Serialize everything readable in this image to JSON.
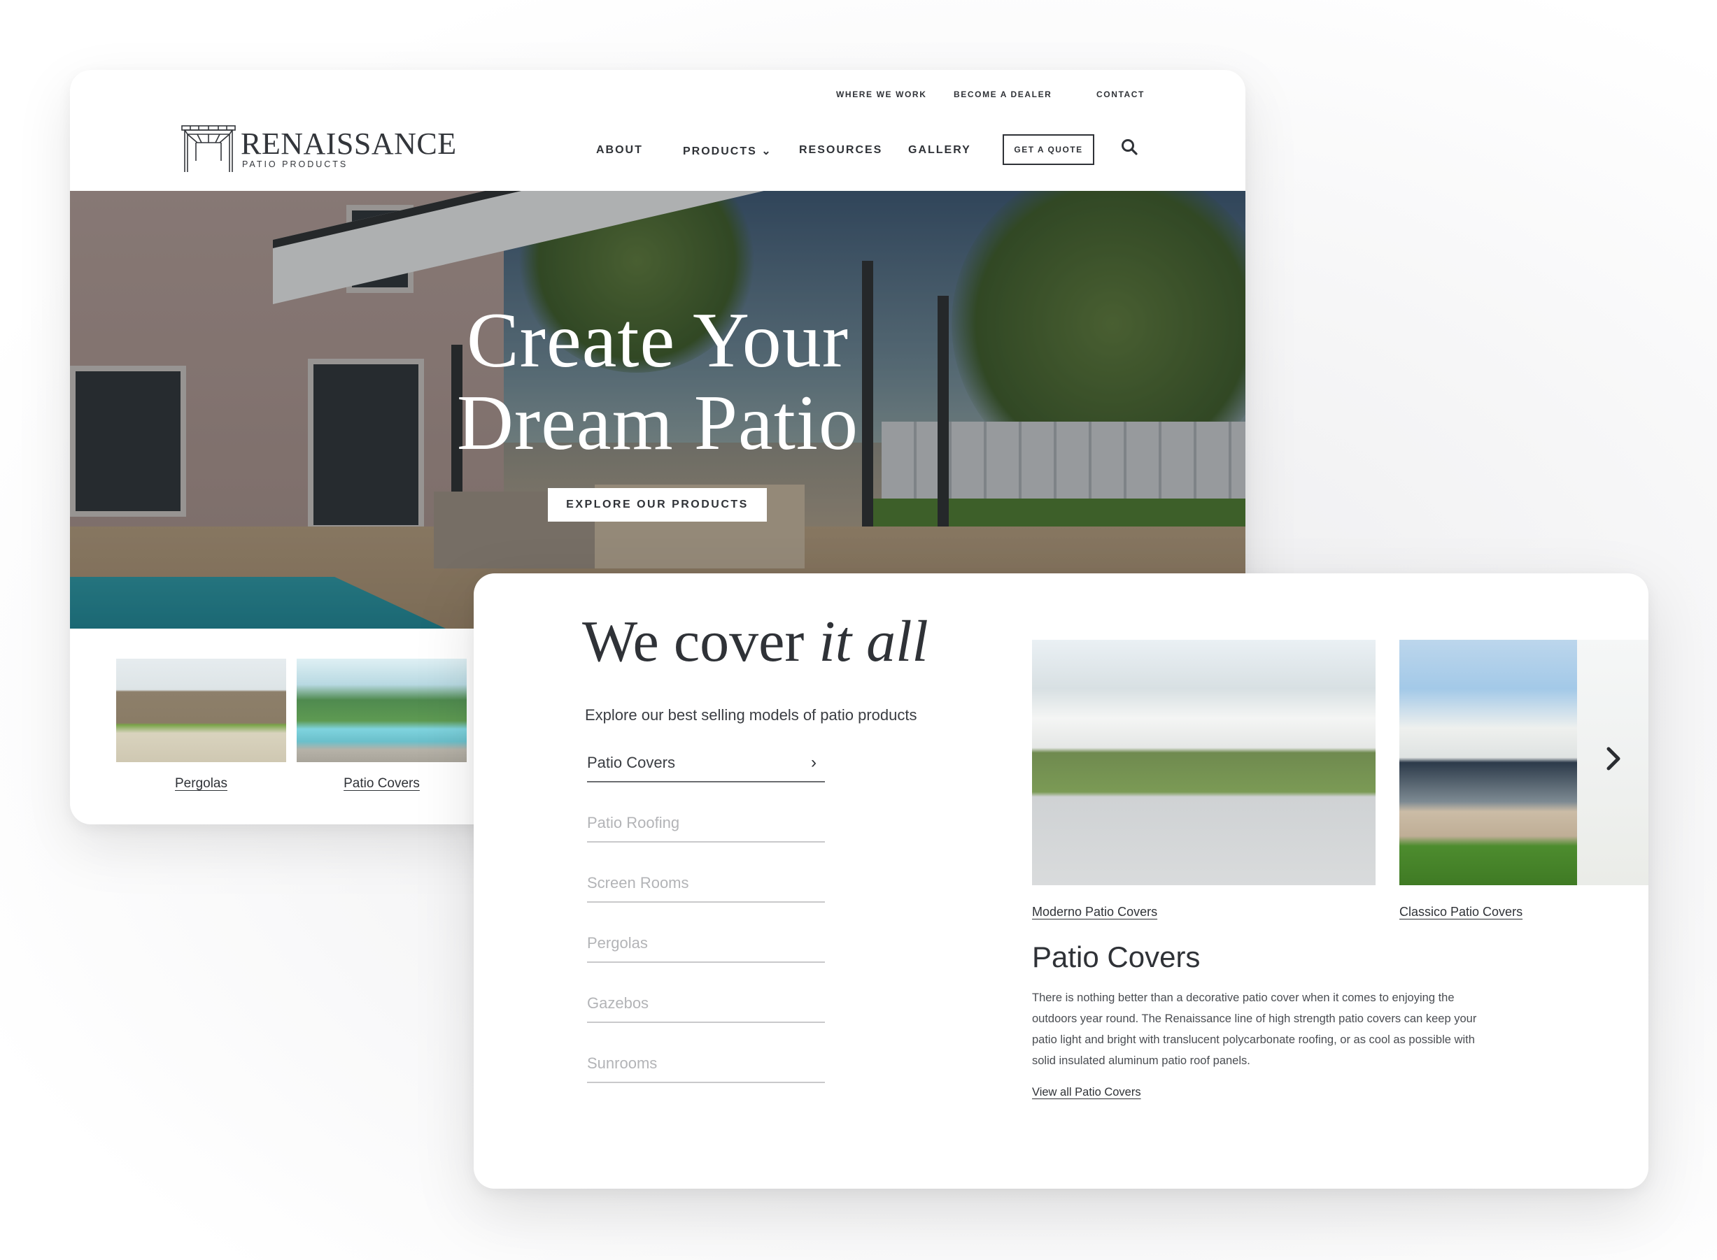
{
  "header": {
    "utility_links": [
      "WHERE WE WORK",
      "BECOME A DEALER",
      "CONTACT"
    ],
    "logo": {
      "wordmark": "RENAISSANCE",
      "tagline": "PATIO PRODUCTS"
    },
    "nav": [
      {
        "label": "ABOUT"
      },
      {
        "label": "PRODUCTS ⌄",
        "has_dropdown": true
      },
      {
        "label": "RESOURCES"
      },
      {
        "label": "GALLERY"
      }
    ],
    "cta_label": "GET A QUOTE",
    "search_icon": "search-icon"
  },
  "hero": {
    "title_line1": "Create Your",
    "title_line2": "Dream Patio",
    "button_label": "EXPLORE OUR PRODUCTS"
  },
  "featured": [
    {
      "label": "Pergolas"
    },
    {
      "label": "Patio Covers"
    }
  ],
  "products_section": {
    "title_regular": "We cover ",
    "title_italic": "it all",
    "subtitle": "Explore our best selling models of patio products",
    "categories": [
      {
        "label": "Patio Covers",
        "active": true
      },
      {
        "label": "Patio Roofing",
        "active": false
      },
      {
        "label": "Screen Rooms",
        "active": false
      },
      {
        "label": "Pergolas",
        "active": false
      },
      {
        "label": "Gazebos",
        "active": false
      },
      {
        "label": "Sunrooms",
        "active": false
      }
    ],
    "carousel": [
      {
        "label": "Moderno Patio Covers"
      },
      {
        "label": "Classico Patio Covers"
      }
    ],
    "next_icon": "chevron-right-icon",
    "detail_title": "Patio Covers",
    "detail_text": "There is nothing better than a decorative patio cover when it comes to enjoying the outdoors year round. The Renaissance line of high strength patio covers can keep your patio light and bright with translucent polycarbonate roofing, or as cool as possible with solid insulated aluminum patio roof panels.",
    "detail_link": "View all Patio Covers"
  },
  "colors": {
    "text_dark": "#2f3237",
    "muted": "#b3b4b7",
    "background": "#ffffff"
  }
}
